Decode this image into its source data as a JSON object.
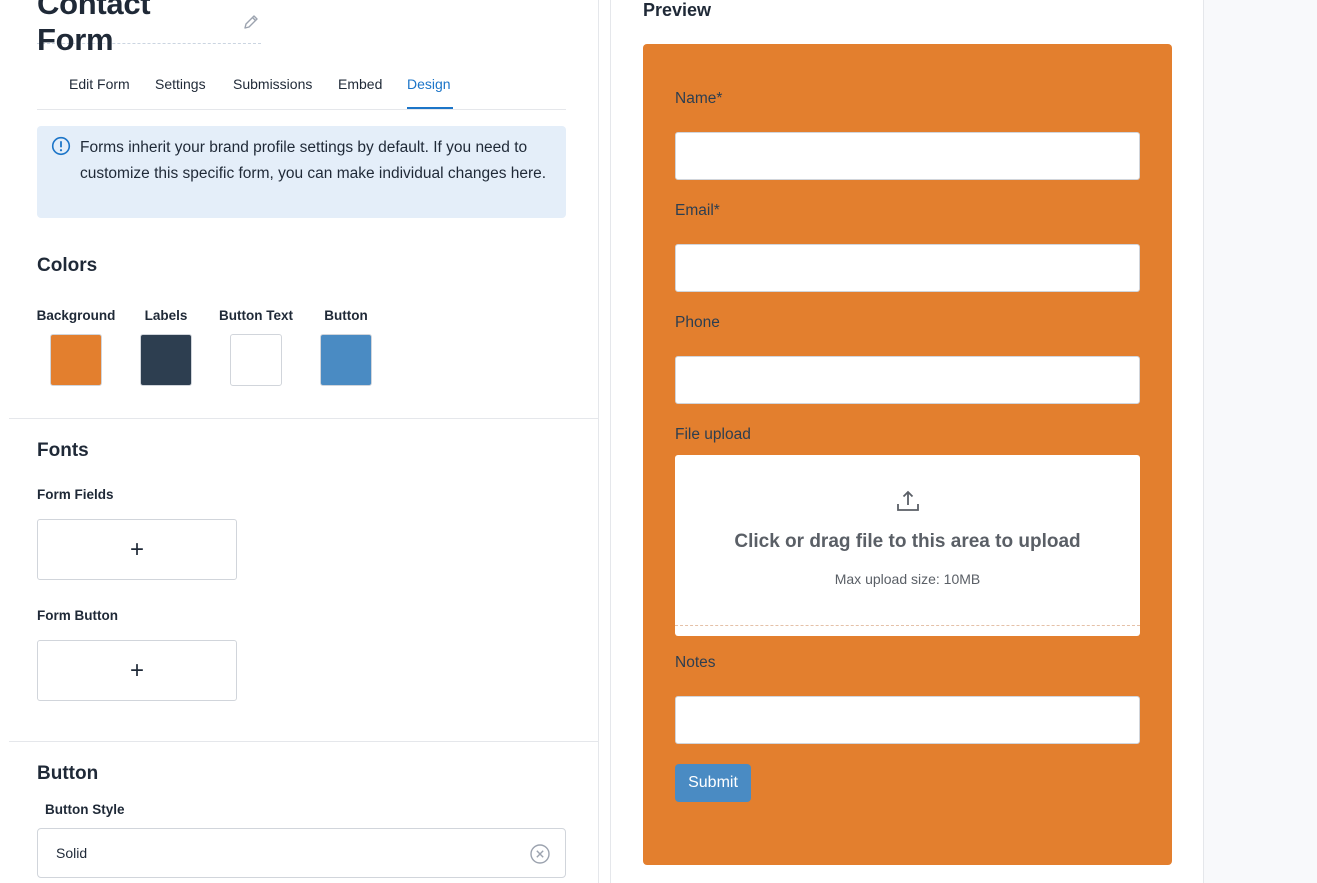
{
  "page": {
    "title": "Contact Form"
  },
  "tabs": [
    {
      "label": "Edit Form"
    },
    {
      "label": "Settings"
    },
    {
      "label": "Submissions"
    },
    {
      "label": "Embed"
    },
    {
      "label": "Design"
    }
  ],
  "active_tab": "Design",
  "info": {
    "text": "Forms inherit your brand profile settings by default. If you need to customize this specific form, you can make individual changes here."
  },
  "colors": {
    "title": "Colors",
    "swatches": [
      {
        "label": "Background",
        "color": "#e37f2e"
      },
      {
        "label": "Labels",
        "color": "#2d3e50"
      },
      {
        "label": "Button Text",
        "color": "#ffffff"
      },
      {
        "label": "Button",
        "color": "#4a8bc3"
      }
    ]
  },
  "fonts": {
    "title": "Fonts",
    "form_fields_label": "Form Fields",
    "form_button_label": "Form Button",
    "add_symbol": "+"
  },
  "button_section": {
    "title": "Button",
    "style_label": "Button Style",
    "style_value": "Solid"
  },
  "preview": {
    "title": "Preview",
    "card_color": "#e37f2e",
    "fields": [
      {
        "label": "Name*"
      },
      {
        "label": "Email*"
      },
      {
        "label": "Phone"
      },
      {
        "label": "File upload"
      },
      {
        "label": "Notes"
      }
    ],
    "upload_text": "Click or drag file to this area to upload",
    "upload_sub": "Max upload size: 10MB",
    "submit_label": "Submit",
    "submit_color": "#4a8bc3"
  }
}
